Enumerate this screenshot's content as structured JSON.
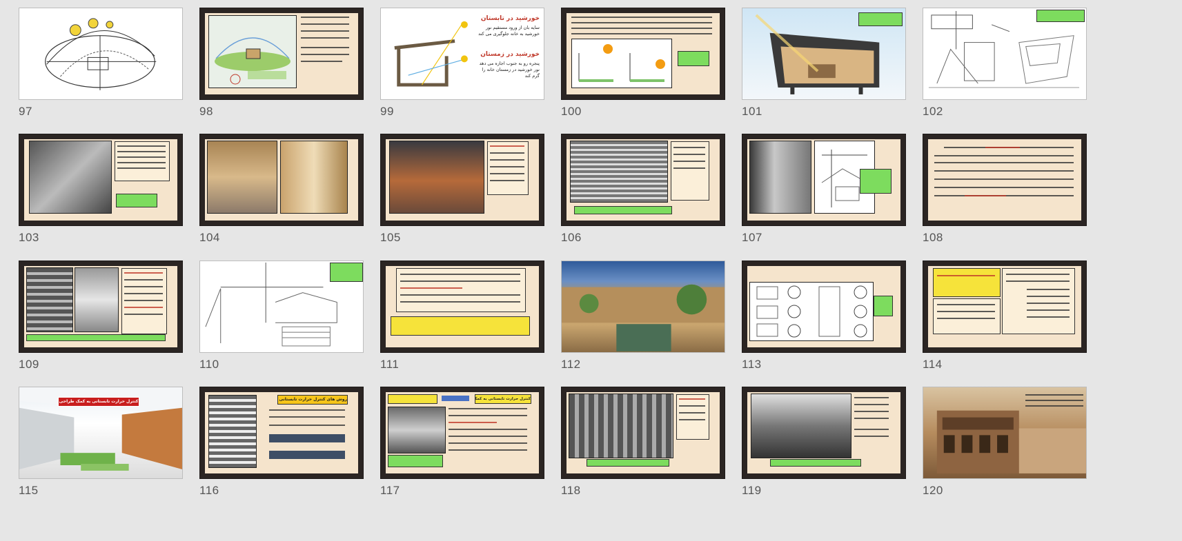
{
  "panel": "slide-sorter",
  "slides": [
    {
      "number": "97",
      "type": "sketch"
    },
    {
      "number": "98",
      "type": "text-image"
    },
    {
      "number": "99",
      "type": "diagram",
      "title_summer": "خورشید در تابستان",
      "body_summer": "سایه بان از ورود مستقیم نور خورشید به خانه جلوگیری می کند",
      "title_winter": "خورشید در زمستان",
      "body_winter": "پنجره رو به جنوب اجازه می دهد نور خورشید در زمستان خانه را گرم کند"
    },
    {
      "number": "100",
      "type": "text-diagram"
    },
    {
      "number": "101",
      "type": "photo"
    },
    {
      "number": "102",
      "type": "sketch"
    },
    {
      "number": "103",
      "type": "photo-text"
    },
    {
      "number": "104",
      "type": "photo-pair"
    },
    {
      "number": "105",
      "type": "photo-text"
    },
    {
      "number": "106",
      "type": "photo-text"
    },
    {
      "number": "107",
      "type": "photo-sketch"
    },
    {
      "number": "108",
      "type": "text"
    },
    {
      "number": "109",
      "type": "photo-text"
    },
    {
      "number": "110",
      "type": "sketch"
    },
    {
      "number": "111",
      "type": "text"
    },
    {
      "number": "112",
      "type": "photo"
    },
    {
      "number": "113",
      "type": "diagram-grid"
    },
    {
      "number": "114",
      "type": "text"
    },
    {
      "number": "115",
      "type": "photo",
      "caption": "کنترل حرارت تابستانی به کمک طراحی"
    },
    {
      "number": "116",
      "type": "photo-text",
      "heading": "روش های کنترل حرارت تابستانی در معماری"
    },
    {
      "number": "117",
      "type": "photo-text",
      "heading": "کنترل حرارت تابستانی به کمک طراحی"
    },
    {
      "number": "118",
      "type": "photo-text"
    },
    {
      "number": "119",
      "type": "photo-text"
    },
    {
      "number": "120",
      "type": "photo"
    }
  ],
  "colors": {
    "background": "#e6e6e6",
    "slide_frame": "#2b2523",
    "slide_paper": "#f5e4cc",
    "highlight_green": "#7ddc5e",
    "highlight_yellow": "#f6e33a"
  }
}
